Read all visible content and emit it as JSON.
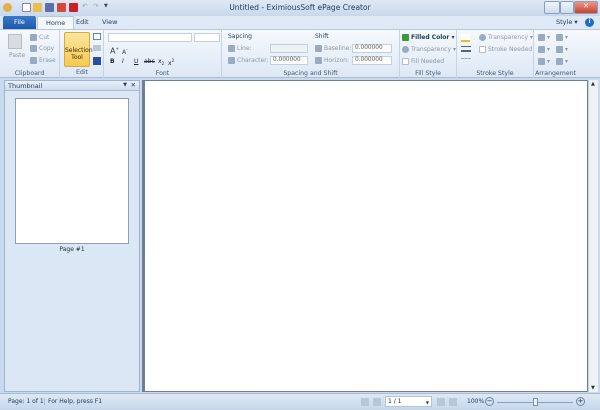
{
  "window": {
    "title": "Untitled - EximiousSoft ePage Creator"
  },
  "tabs": {
    "file": "File",
    "home": "Home",
    "edit": "Edit",
    "view": "View",
    "style": "Style"
  },
  "clipboard": {
    "paste": "Paste",
    "cut": "Cut",
    "copy": "Copy",
    "erase": "Erase",
    "label": "Clipboard"
  },
  "edit_group": {
    "selection_tool": "Selection Tool",
    "label": "Edit"
  },
  "font": {
    "label": "Font",
    "font_name": "",
    "font_size": ""
  },
  "spacing": {
    "title": "Sapcing",
    "line": "Line:",
    "character": "Character:",
    "character_value": "0.000000",
    "label": "Spacing and Shift"
  },
  "shift": {
    "title": "Shift",
    "baseline": "Baseline:",
    "baseline_value": "0.000000",
    "horizon": "Horizon:",
    "horizon_value": "0.000000"
  },
  "fill": {
    "filled_color": "Filled Color",
    "transparency": "Transparency",
    "fill_needed": "Fill Needed",
    "label": "Fill Style"
  },
  "stroke": {
    "transparency": "Transparency",
    "stroke_needed": "Stroke Needed",
    "label": "Stroke Style"
  },
  "arrangement": {
    "label": "Arrangement"
  },
  "panel": {
    "title": "Thumbnail",
    "page_label": "Page #1"
  },
  "status": {
    "page": "Page: 1 of 1",
    "help": "For Help, press F1",
    "page_field": "1 / 1",
    "zoom": "100%"
  },
  "zoom_level_percent": 100
}
